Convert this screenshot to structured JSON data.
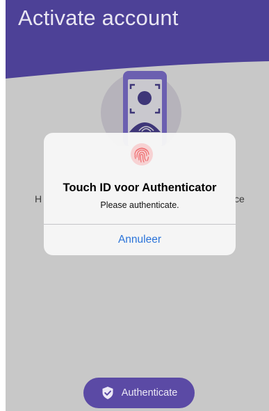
{
  "header": {
    "title": "Activate account"
  },
  "background": {
    "left_fragment": "H",
    "right_fragment": "ce"
  },
  "dialog": {
    "icon": "fingerprint-icon",
    "title": "Touch ID voor Authenticator",
    "message": "Please authenticate.",
    "cancel_label": "Annuleer"
  },
  "footer": {
    "authenticate_label": "Authenticate",
    "authenticate_icon": "shield-check-icon"
  },
  "colors": {
    "header_purple": "#5a4aa6",
    "dimmed_background": "#c8c8c8",
    "dialog_link_blue": "#2a73d9",
    "fingerprint_red": "#ef6f72"
  }
}
